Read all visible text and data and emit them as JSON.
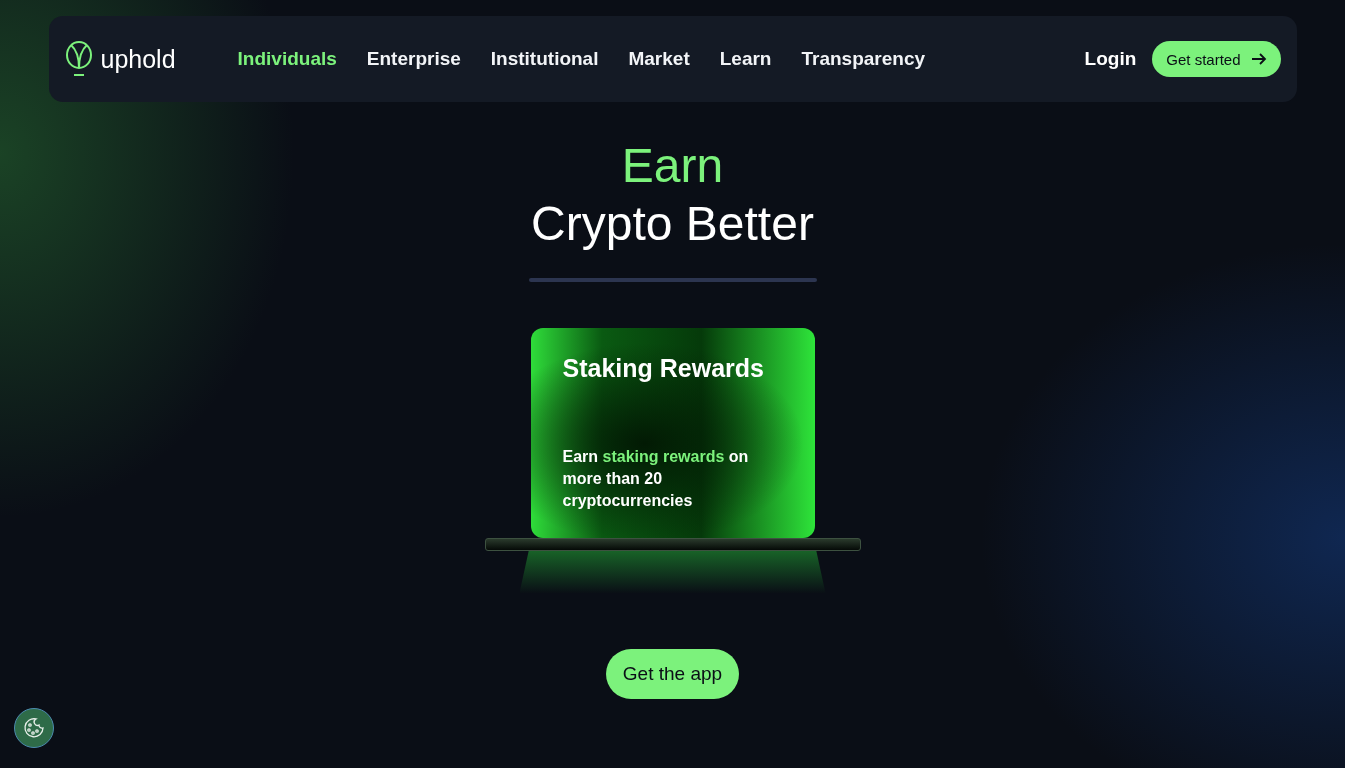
{
  "nav": {
    "logo": "uphold",
    "items": [
      {
        "label": "Individuals",
        "selected": true
      },
      {
        "label": "Enterprise",
        "selected": false
      },
      {
        "label": "Institutional",
        "selected": false
      },
      {
        "label": "Market",
        "selected": false
      },
      {
        "label": "Learn",
        "selected": false
      },
      {
        "label": "Transparency",
        "selected": false
      }
    ],
    "login": "Login",
    "cta": "Get started"
  },
  "hero": {
    "title_accent": "Earn",
    "title": "Crypto Better"
  },
  "card": {
    "title": "Staking Rewards",
    "description": [
      {
        "text": "Earn ",
        "highlight": false
      },
      {
        "text": "staking rewards",
        "highlight": true
      },
      {
        "text": " on more than 20 cryptocurrencies",
        "highlight": false
      }
    ]
  },
  "app_button": "Get the app"
}
